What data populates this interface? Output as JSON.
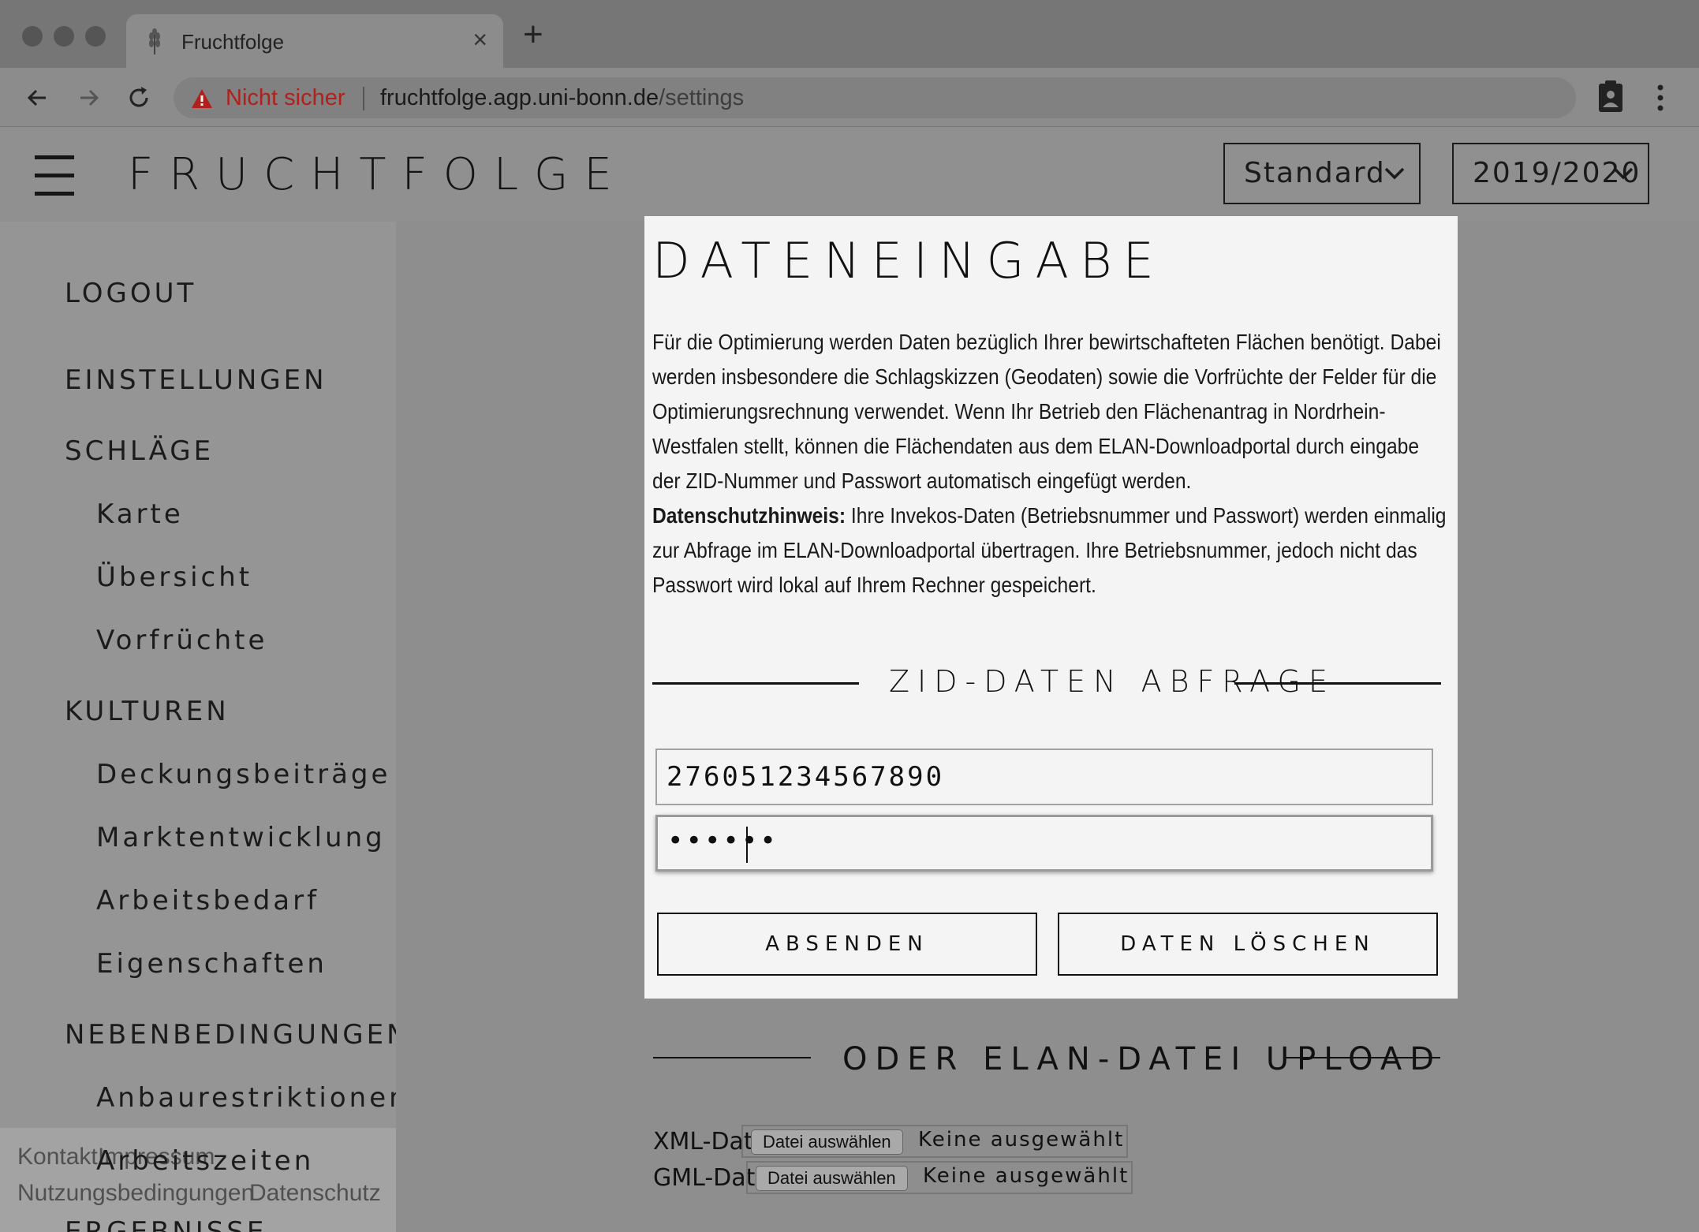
{
  "browser": {
    "tab_title": "Fruchtfolge",
    "tab_close": "×",
    "new_tab": "+",
    "security_label": "Nicht sicher",
    "url_host": "fruchtfolge.agp.uni-bonn.de",
    "url_path": "/settings"
  },
  "header": {
    "brand": "FRUCHTFOLGE",
    "scenario_select": "Standard",
    "year_select": "2019/2020"
  },
  "sidebar": {
    "items": [
      {
        "label": "LOGOUT"
      },
      {
        "label": "EINSTELLUNGEN"
      },
      {
        "label": "SCHLÄGE"
      },
      {
        "label": "Karte"
      },
      {
        "label": "Übersicht"
      },
      {
        "label": "Vorfrüchte"
      },
      {
        "label": "KULTUREN"
      },
      {
        "label": "Deckungsbeiträge"
      },
      {
        "label": "Marktentwicklung"
      },
      {
        "label": "Arbeitsbedarf"
      },
      {
        "label": "Eigenschaften"
      },
      {
        "label": "NEBENBEDINGUNGEN"
      },
      {
        "label": "Anbaurestriktionen"
      },
      {
        "label": "Arbeitszeiten"
      },
      {
        "label": "ERGEBNISSE"
      }
    ],
    "footer": {
      "kontakt": "Kontakt",
      "impressum": "Impressum",
      "nutzungsbedingungen": "Nutzungsbedingungen",
      "datenschutz": "Datenschutz"
    }
  },
  "modal": {
    "title": "DATENEINGABE",
    "intro": "Für die Optimierung werden Daten bezüglich Ihrer bewirtschafteten Flächen benötigt. Dabei werden insbesondere die Schlagskizzen (Geodaten) sowie die Vorfrüchte der Felder für die Optimierungsrechnung verwendet. Wenn Ihr Betrieb den Flächenantrag in Nordrhein-Westfalen stellt, können die Flächendaten aus dem ELAN-Downloadportal durch eingabe der ZID-Nummer und Passwort automatisch eingefügt werden.",
    "privacy_label": "Datenschutzhinweis:",
    "privacy_text": " Ihre Invekos-Daten (Betriebsnummer und Passwort) werden einmalig zur Abfrage im ELAN-Downloadportal übertragen. Ihre Betriebsnummer, jedoch nicht das Passwort wird lokal auf Ihrem Rechner gespeichert.",
    "section_heading": "ZID-DATEN ABFRAGE",
    "zid_value": "276051234567890",
    "password_value": "••••••",
    "submit_label": "ABSENDEN",
    "delete_label": "DATEN LÖSCHEN"
  },
  "upload": {
    "heading": "ODER ELAN-DATEI UPLOAD",
    "xml_label": "XML-Datei",
    "gml_label": "GML-Datei",
    "choose_label": "Datei auswählen",
    "none_selected": "Keine ausgewählt"
  },
  "colors": {
    "overlay": "#8e8e8e",
    "modal_bg": "#f4f4f4",
    "warning_red": "#b0201c"
  }
}
